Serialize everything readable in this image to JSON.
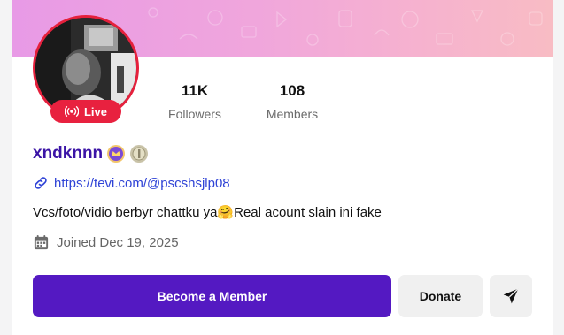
{
  "profile": {
    "name": "xndknnn",
    "live_label": "Live",
    "link": "https://tevi.com/@pscshsjlp08",
    "bio": "Vcs/foto/vidio berbyr chattku ya🤗Real acount slain ini fake",
    "joined": "Joined Dec 19, 2025"
  },
  "stats": {
    "followers": {
      "value": "11K",
      "label": "Followers"
    },
    "members": {
      "value": "108",
      "label": "Members"
    }
  },
  "actions": {
    "member_label": "Become a Member",
    "donate_label": "Donate"
  },
  "icons": {
    "live": "broadcast-icon",
    "link": "link-icon",
    "calendar": "calendar-icon",
    "send": "send-icon",
    "badge_vip": "crown-badge-icon",
    "badge_level": "level-medal-icon"
  },
  "colors": {
    "accent": "#5419c2",
    "name": "#3b14a6",
    "live": "#e8213f",
    "link": "#2f43d6"
  }
}
